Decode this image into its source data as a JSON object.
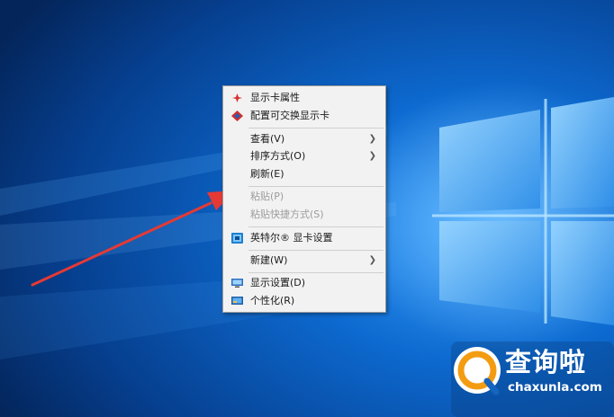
{
  "context_menu": {
    "items": [
      {
        "label": "显示卡属性",
        "icon": "graphics-properties-icon"
      },
      {
        "label": "配置可交换显示卡",
        "icon": "switchable-graphics-icon"
      },
      {
        "label": "查看(V)",
        "submenu": true
      },
      {
        "label": "排序方式(O)",
        "submenu": true
      },
      {
        "label": "刷新(E)"
      },
      {
        "label": "粘贴(P)",
        "disabled": true
      },
      {
        "label": "粘贴快捷方式(S)",
        "disabled": true
      },
      {
        "label": "英特尔® 显卡设置",
        "icon": "intel-graphics-icon"
      },
      {
        "label": "新建(W)",
        "submenu": true
      },
      {
        "label": "显示设置(D)",
        "icon": "display-settings-icon"
      },
      {
        "label": "个性化(R)",
        "icon": "personalize-icon"
      }
    ],
    "submenu_glyph": "❯"
  },
  "watermark": {
    "brand": "查询啦",
    "domain": "chaxunla.com"
  },
  "colors": {
    "desktop_blue": "#0a5fb8",
    "arrow_red": "#e53935",
    "menu_bg": "#f2f2f2"
  }
}
